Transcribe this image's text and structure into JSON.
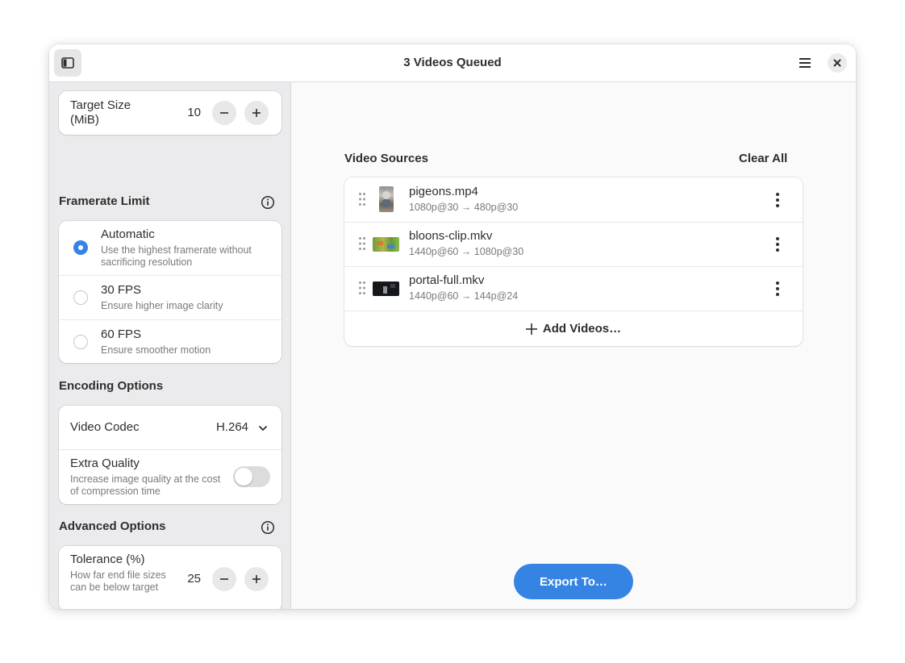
{
  "window": {
    "title": "3 Videos Queued"
  },
  "sidebar": {
    "target_size": {
      "label": "Target Size (MiB)",
      "value": "10"
    },
    "framerate": {
      "title": "Framerate Limit",
      "options": [
        {
          "title": "Automatic",
          "subtitle": "Use the highest framerate without sacrificing resolution",
          "selected": true
        },
        {
          "title": "30 FPS",
          "subtitle": "Ensure higher image clarity",
          "selected": false
        },
        {
          "title": "60 FPS",
          "subtitle": "Ensure smoother motion",
          "selected": false
        }
      ]
    },
    "encoding": {
      "title": "Encoding Options",
      "codec_label": "Video Codec",
      "codec_value": "H.264",
      "extra_quality": {
        "title": "Extra Quality",
        "subtitle": "Increase image quality at the cost of compression time",
        "enabled": false
      }
    },
    "advanced": {
      "title": "Advanced Options",
      "tolerance": {
        "title": "Tolerance (%)",
        "subtitle": "How far end file sizes can be below target",
        "value": "25"
      }
    }
  },
  "main": {
    "sources_title": "Video Sources",
    "clear_all": "Clear All",
    "videos": [
      {
        "name": "pigeons.mp4",
        "info": "1080p@30 → 480p@30"
      },
      {
        "name": "bloons-clip.mkv",
        "info": "1440p@60 → 1080p@30"
      },
      {
        "name": "portal-full.mkv",
        "info": "1440p@60 → 144p@24"
      }
    ],
    "add_videos": "Add Videos…",
    "export": "Export To…"
  },
  "colors": {
    "accent": "#3584e4",
    "sidebar_bg": "#ebebed",
    "main_bg": "#fafafa"
  },
  "icons": [
    "sidebar-toggle-icon",
    "hamburger-menu-icon",
    "close-icon",
    "minus-icon",
    "plus-icon",
    "info-icon",
    "chevron-down-icon",
    "drag-handle-icon",
    "kebab-menu-icon"
  ]
}
